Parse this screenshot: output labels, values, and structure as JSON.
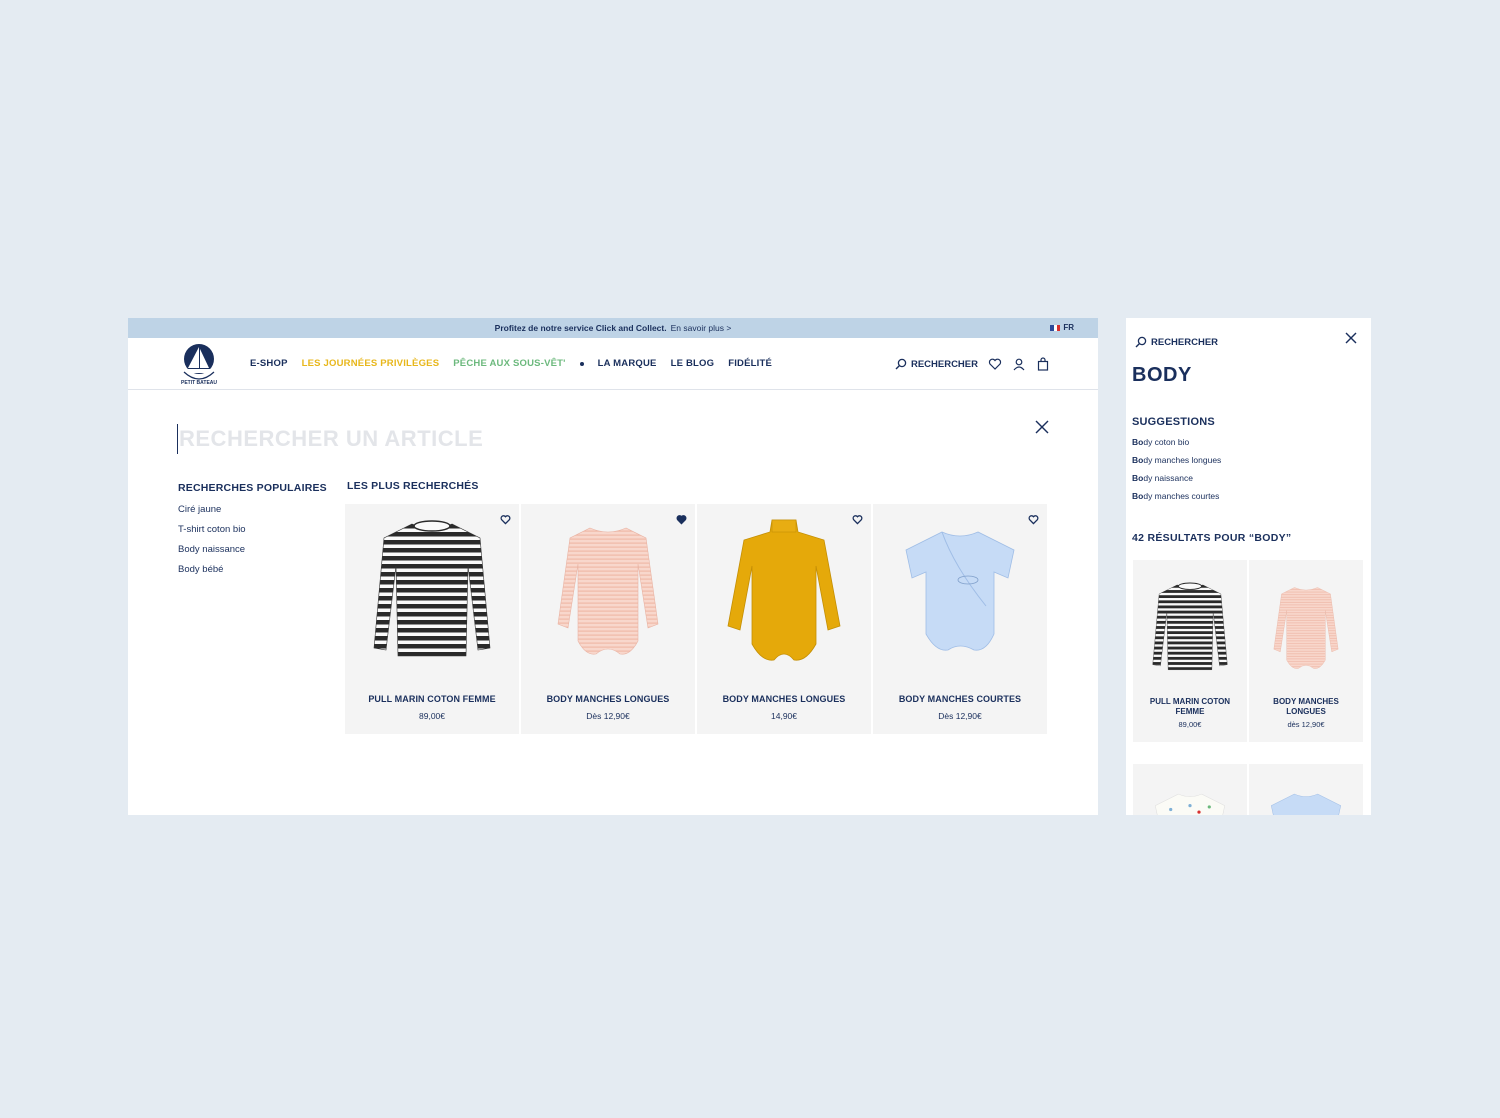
{
  "promo": {
    "text": "Profitez de notre service Click and Collect.",
    "link": "En savoir plus >",
    "lang": "FR"
  },
  "nav": {
    "items": [
      "E-SHOP",
      "LES JOURNÉES PRIVILÈGES",
      "PÊCHE AUX SOUS-VÊT'",
      "LA MARQUE",
      "LE BLOG",
      "FIDÉLITÉ"
    ],
    "search_label": "RECHERCHER"
  },
  "search": {
    "placeholder": "RECHERCHER UN ARTICLE",
    "popular_title": "RECHERCHES POPULAIRES",
    "popular": [
      "Ciré jaune",
      "T-shirt coton bio",
      "Body naissance",
      "Body bébé"
    ],
    "most_title": "LES PLUS RECHERCHÉS"
  },
  "products": [
    {
      "name": "PULL MARIN COTON FEMME",
      "price": "89,00€",
      "favorited": false
    },
    {
      "name": "BODY MANCHES LONGUES",
      "price": "Dès 12,90€",
      "favorited": true
    },
    {
      "name": "BODY MANCHES LONGUES",
      "price": "14,90€",
      "favorited": false
    },
    {
      "name": "BODY MANCHES COURTES",
      "price": "Dès 12,90€",
      "favorited": false
    }
  ],
  "mobile": {
    "search_label": "RECHERCHER",
    "query": "BODY",
    "suggestions_title": "SUGGESTIONS",
    "suggestions": [
      {
        "bold": "Bo",
        "rest": "dy coton bio"
      },
      {
        "bold": "Bo",
        "rest": "dy manches longues"
      },
      {
        "bold": "Bo",
        "rest": "dy naissance"
      },
      {
        "bold": "Bo",
        "rest": "dy manches courtes"
      }
    ],
    "results_title": "42 RÉSULTATS POUR “BODY”",
    "results": [
      {
        "name": "PULL MARIN COTON FEMME",
        "price": "89,00€"
      },
      {
        "name": "BODY MANCHES LONGUES",
        "price": "dès 12,90€"
      }
    ]
  },
  "colors": {
    "navy": "#1a2f5c",
    "promo_bg": "#bed3e6",
    "yellow": "#e8b71b",
    "green": "#6cb97d",
    "page_bg": "#e4ebf2",
    "card_bg": "#f4f4f4"
  },
  "icons": [
    "search-icon",
    "heart-icon",
    "user-icon",
    "bag-icon",
    "close-icon",
    "logo-icon"
  ]
}
